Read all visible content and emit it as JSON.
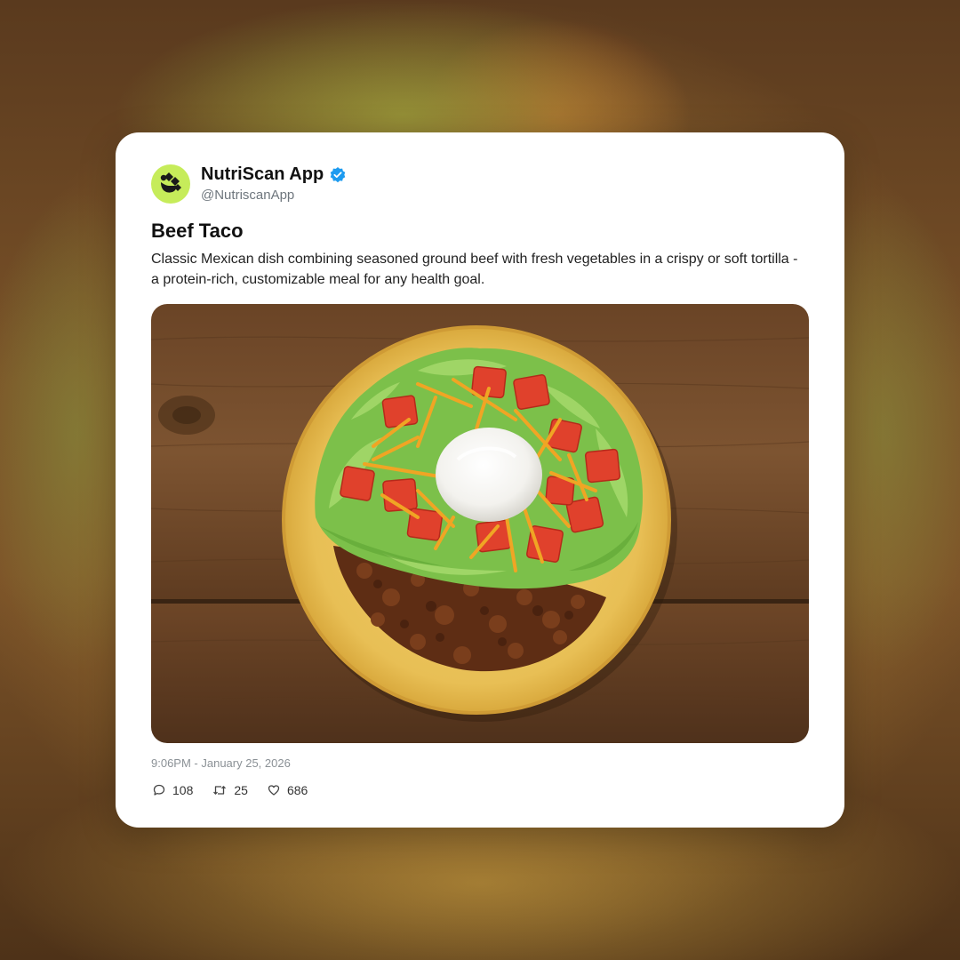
{
  "account": {
    "name": "NutriScan App",
    "handle": "@NutriscanApp",
    "verified": true
  },
  "post": {
    "title": "Beef Taco",
    "description": "Classic Mexican dish combining seasoned ground beef with fresh vegetables in a crispy or soft tortilla - a protein-rich, customizable meal for any health goal.",
    "timestamp": "9:06PM - January 25, 2026"
  },
  "stats": {
    "replies": "108",
    "reposts": "25",
    "likes": "686"
  },
  "colors": {
    "avatar_bg": "#c6ec5a",
    "verified_badge": "#1d9bf0",
    "card_bg": "#ffffff"
  },
  "icons": {
    "verified": "verified-badge-icon",
    "reply": "comment-icon",
    "repost": "repost-icon",
    "like": "heart-icon"
  }
}
